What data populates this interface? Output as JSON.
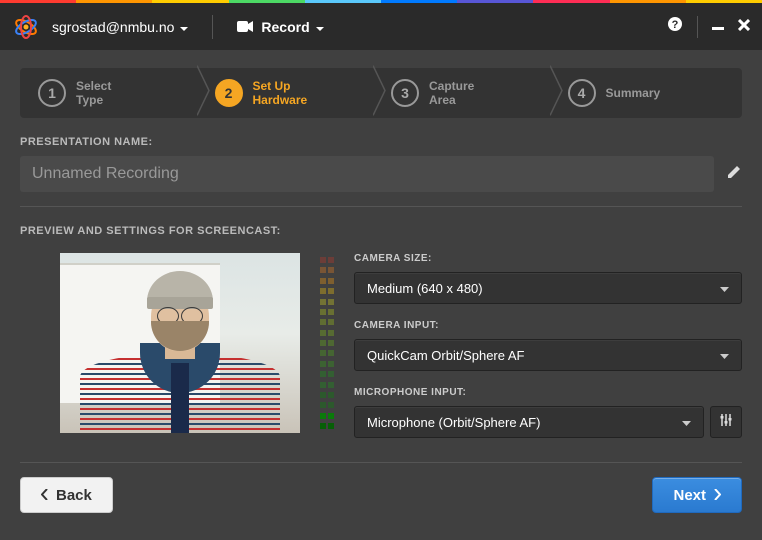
{
  "colors": {
    "strip": [
      "#ff3b30",
      "#ff9500",
      "#ffcc00",
      "#4cd964",
      "#5ac8fa",
      "#007aff",
      "#5856d6",
      "#ff2d55",
      "#ff9500",
      "#ffcc00"
    ]
  },
  "topbar": {
    "user": "sgrostad@nmbu.no",
    "record": "Record"
  },
  "steps": [
    {
      "num": "1",
      "label": "Select\nType"
    },
    {
      "num": "2",
      "label": "Set Up\nHardware"
    },
    {
      "num": "3",
      "label": "Capture\nArea"
    },
    {
      "num": "4",
      "label": "Summary"
    }
  ],
  "active_step": 2,
  "presentation_label": "PRESENTATION NAME:",
  "presentation_name": "Unnamed Recording",
  "preview_label": "PREVIEW AND SETTINGS FOR SCREENCAST:",
  "settings": {
    "camera_size_label": "CAMERA SIZE:",
    "camera_size_value": "Medium (640 x 480)",
    "camera_input_label": "CAMERA INPUT:",
    "camera_input_value": "QuickCam Orbit/Sphere AF",
    "mic_input_label": "MICROPHONE INPUT:",
    "mic_input_value": "Microphone (Orbit/Sphere AF)"
  },
  "meter_colors": [
    "#c0392b",
    "#e67e22",
    "#f39c12",
    "#f1c40f",
    "#d4d420",
    "#b8cc1a",
    "#9ec41a",
    "#84bc1a",
    "#6ab41a",
    "#50ac1a",
    "#36a41a",
    "#1c9c1a",
    "#1c9c1a",
    "#0a8a0a",
    "#0a8a0a",
    "#0a7a0a",
    "#065f06"
  ],
  "meter_dim_above": 15,
  "footer": {
    "back": "Back",
    "next": "Next"
  }
}
